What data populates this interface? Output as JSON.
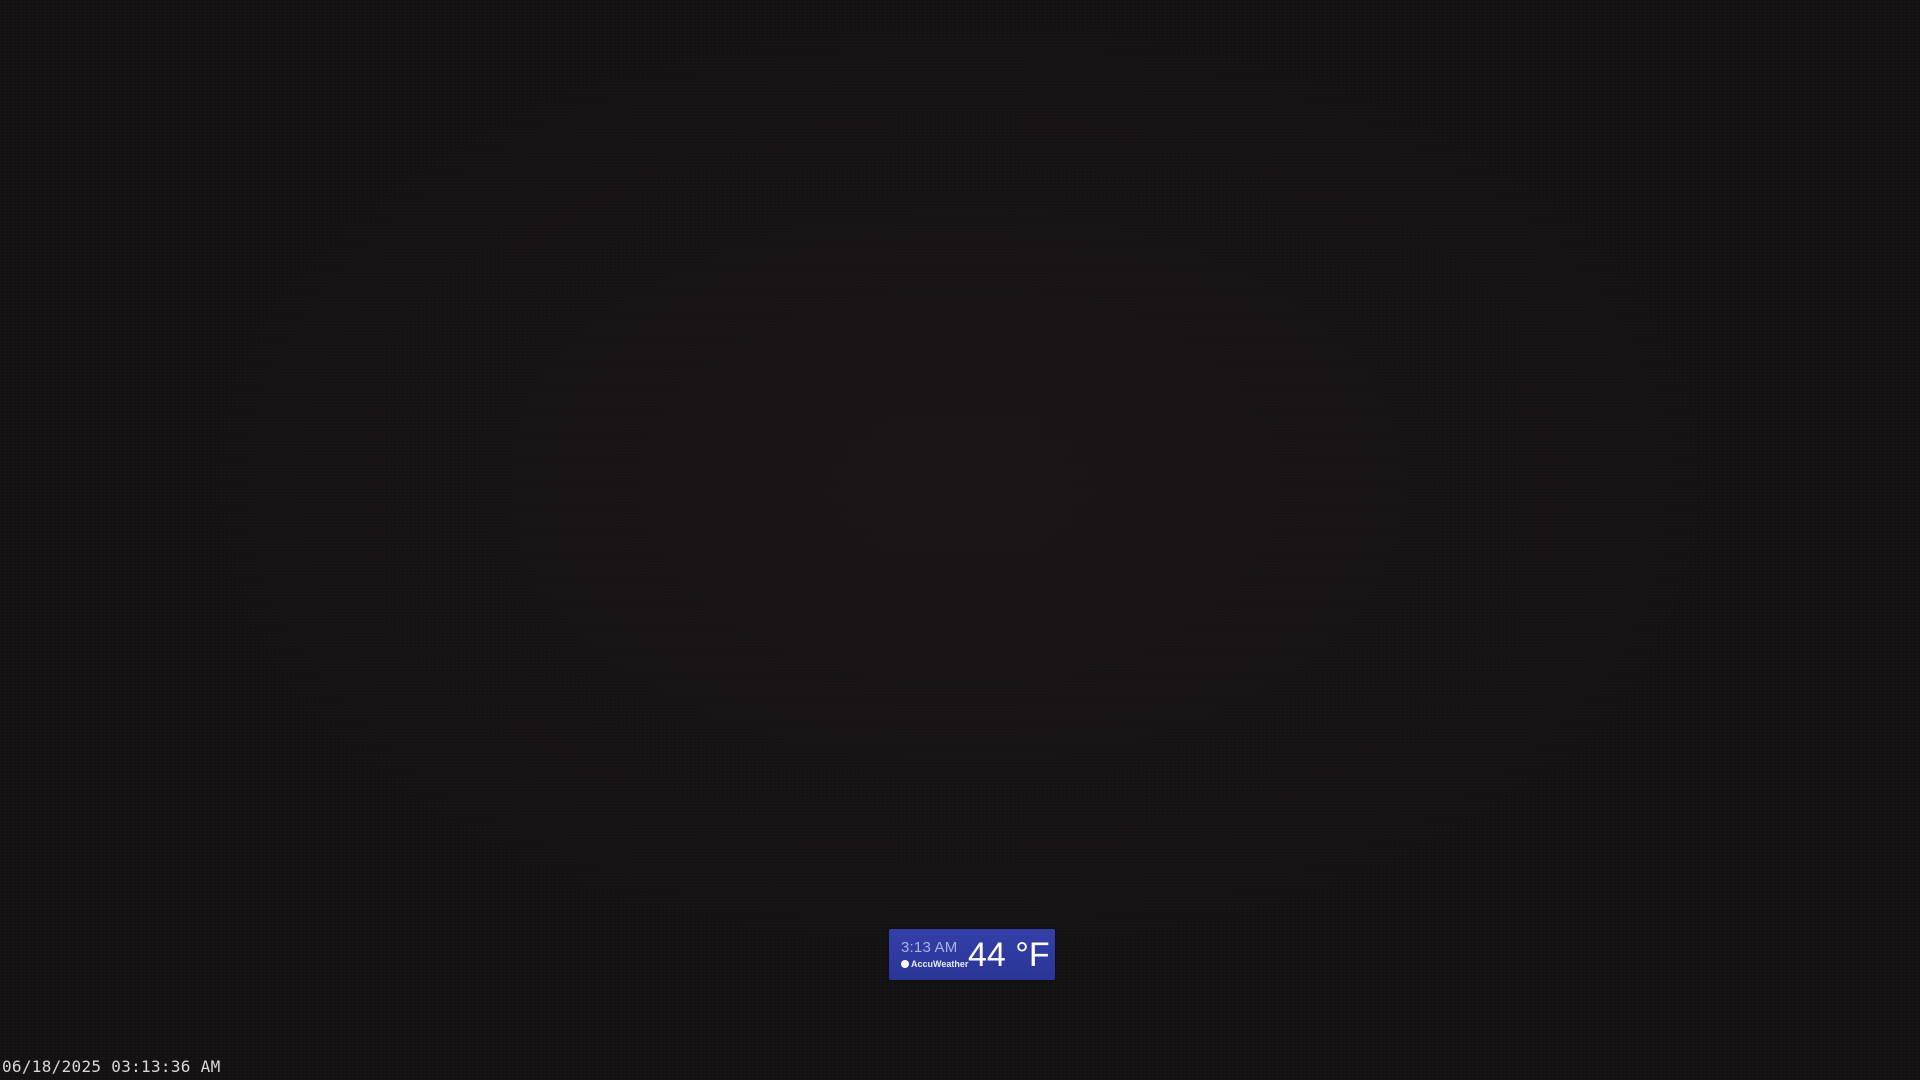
{
  "camera": {
    "timestamp": "06/18/2025 03:13:36 AM"
  },
  "weather_badge": {
    "time": "3:13 AM",
    "brand": "AccuWeather",
    "brand_icon": "accuweather-sun-icon",
    "temperature": "44 °F",
    "background_color": "#3340a8"
  }
}
